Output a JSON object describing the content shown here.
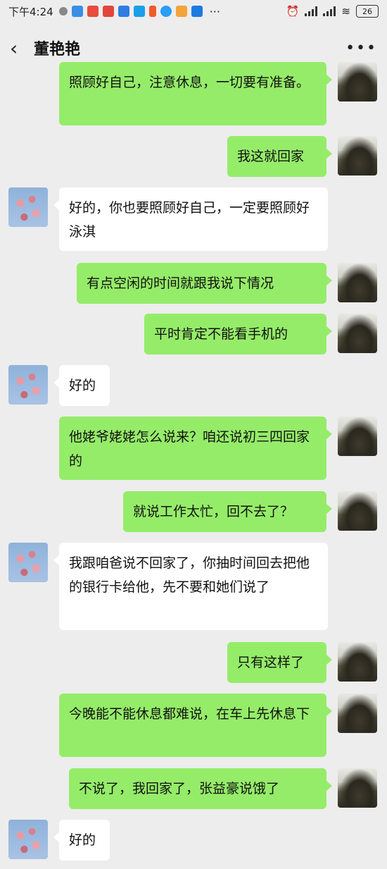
{
  "status_bar": {
    "time": "下午4:24",
    "battery": "26"
  },
  "header": {
    "back_icon": "chevron-left-icon",
    "contact_name": "董艳艳",
    "more_icon": "more-dots-icon"
  },
  "messages": [
    {
      "side": "mine",
      "text": "照顾好自己，注意休息，一切要有准备。"
    },
    {
      "side": "mine",
      "text": "我这就回家"
    },
    {
      "side": "theirs",
      "text": "好的，你也要照顾好自己，一定要照顾好泳淇"
    },
    {
      "side": "mine",
      "text": "有点空闲的时间就跟我说下情况"
    },
    {
      "side": "mine",
      "text": "平时肯定不能看手机的"
    },
    {
      "side": "theirs",
      "text": "好的"
    },
    {
      "side": "mine",
      "text": "他姥爷姥姥怎么说来？咱还说初三四回家的"
    },
    {
      "side": "mine",
      "text": "就说工作太忙，回不去了？"
    },
    {
      "side": "theirs",
      "text": "我跟咱爸说不回家了，你抽时间回去把他的银行卡给他，先不要和她们说了"
    },
    {
      "side": "mine",
      "text": "只有这样了"
    },
    {
      "side": "mine",
      "text": "今晚能不能休息都难说，在车上先休息下"
    },
    {
      "side": "mine",
      "text": "不说了，我回家了，张益豪说饿了"
    },
    {
      "side": "theirs",
      "text": "好的"
    }
  ],
  "colors": {
    "background": "#ededed",
    "mine_bubble": "#95ec69",
    "theirs_bubble": "#ffffff"
  }
}
